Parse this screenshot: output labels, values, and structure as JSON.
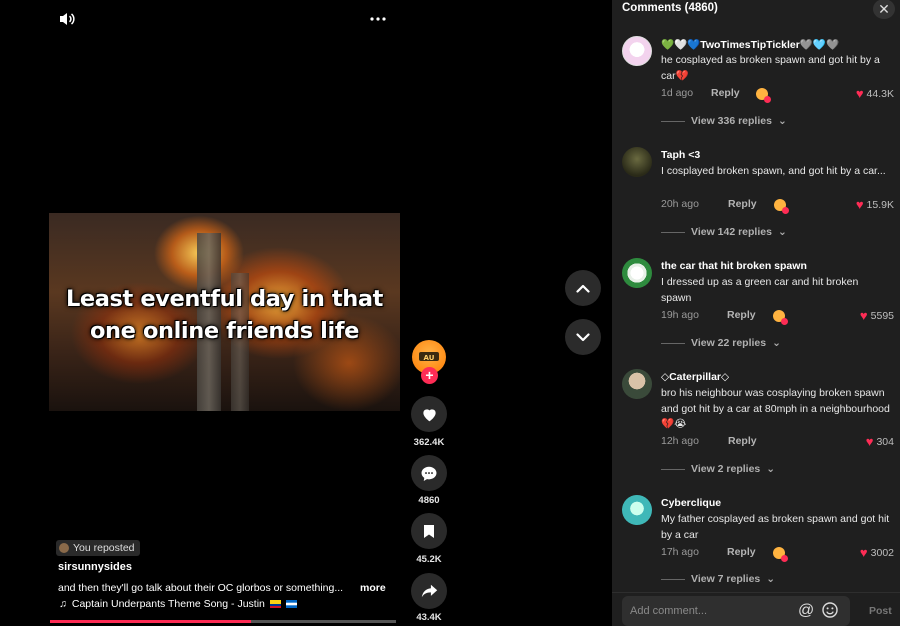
{
  "video": {
    "caption_line1": "Least eventful day in that",
    "caption_line2": "one online friends life",
    "repost_label": "You reposted",
    "username": "sirsunnysides",
    "description": "and then they'll go talk about their OC glorbos or something...",
    "more_label": "more",
    "music": "Captain Underpants Theme Song - Justin",
    "progress": 0.58
  },
  "actions": {
    "likes": "362.4K",
    "comments": "4860",
    "saves": "45.2K",
    "shares": "43.4K"
  },
  "comments_panel": {
    "title": "Comments (4860)",
    "input_placeholder": "Add comment...",
    "post_label": "Post",
    "reply_label": "Reply",
    "items": [
      {
        "name": "💚🤍💙TwoTimesTipTickler🩶🩵🩶",
        "text": "he cosplayed as broken spawn and got hit by a car💔",
        "time": "1d ago",
        "likes": "44.3K",
        "replies": "View 336 replies"
      },
      {
        "name": "Taph <3",
        "text": "I cosplayed broken spawn, and got hit by a car...",
        "time": "20h ago",
        "likes": "15.9K",
        "replies": "View 142 replies"
      },
      {
        "name": "the car that hit broken spawn",
        "text": "I dressed up as a green car and hit broken spawn",
        "time": "19h ago",
        "likes": "5595",
        "replies": "View 22 replies"
      },
      {
        "name": "◇Caterpillar◇",
        "text": "bro his neighbour was cosplaying broken spawn and got hit by a car at 80mph in a neighbourhood💔😭",
        "time": "12h ago",
        "likes": "304",
        "replies": "View 2 replies"
      },
      {
        "name": "Cyberclique",
        "text": "My father cosplayed as broken spawn and got hit by a car",
        "time": "17h ago",
        "likes": "3002",
        "replies": "View 7 replies"
      }
    ]
  }
}
